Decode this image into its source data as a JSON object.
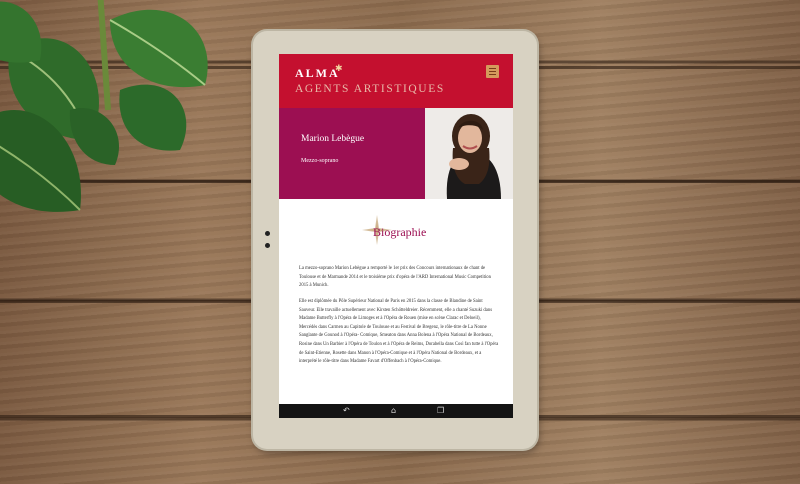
{
  "brand": {
    "logo": "ALMA",
    "subtitle": "AGENTS ARTISTIQUES"
  },
  "profile": {
    "name": "Marion Lebègue",
    "voice": "Mezzo-soprano"
  },
  "biography": {
    "title": "Biographie",
    "paragraphs": [
      "La mezzo-soprano Marion Lebègue a remporté le 1er prix des Concours internationaux de chant de Toulouse et de Marmande 2014 et le troisième prix d'opéra de l'ARD International Music Competition 2015 à Munich.",
      "Elle est diplômée du Pôle Supérieur National de Paris en 2015 dans la classe de Blandine de Saint Sauveur. Elle travaille actuellement avec Kirsten Schötteldreier. Récemment, elle a chanté Suzuki dans Madame Butterfly à l'Opéra de Limoges et à l'Opéra de Rouen (mise en scène Clarac et Deloeil), Mercédès dans Carmen au Capitole de Toulouse et au Festival de Bregenz, le rôle-titre de La Nonne Sanglante de Gounod à l'Opéra- Comique, Smeaton dans Anna Bolena à l'Opéra National de Bordeaux, Rosine dans Un Barbier à l'Opéra de Toulon et à l'Opéra de Reims, Dorabella dans Così fan tutte à l'Opéra de Saint-Etienne, Rosette dans Manon à l'Opéra-Comique et à l'Opéra National de Bordeaux, et a interprété le rôle-titre dans Madame Favart d'Offenbach à l'Opéra-Comique."
    ]
  },
  "colors": {
    "header": "#c4102f",
    "profile_bg": "#9c0f52",
    "accent": "#9c0f52"
  },
  "icons": [
    "menu-icon",
    "back-icon",
    "home-icon",
    "recent-apps-icon"
  ]
}
